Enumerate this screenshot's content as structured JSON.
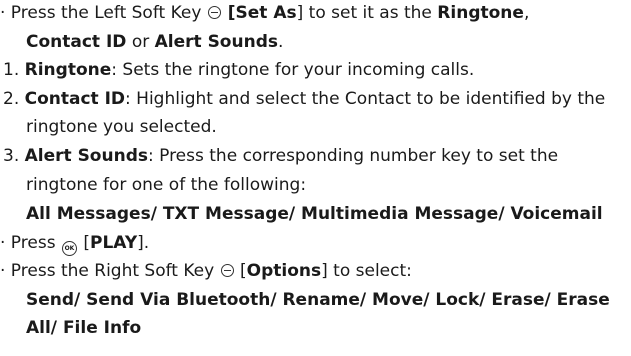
{
  "page": {
    "lines": [
      {
        "id": "l1",
        "parts": [
          {
            "t": "· Press the Left Soft Key "
          },
          {
            "icon": "left-soft-key-icon"
          },
          {
            "t": " [Set As",
            "b": true
          },
          {
            "t": "] to set it as the "
          },
          {
            "t": "Ringtone",
            "b": true
          },
          {
            "t": ","
          }
        ]
      },
      {
        "id": "l2",
        "parts": [
          {
            "t": "Contact ID",
            "b": true
          },
          {
            "t": " or "
          },
          {
            "t": "Alert Sounds",
            "b": true
          },
          {
            "t": "."
          }
        ]
      },
      {
        "id": "l3",
        "parts": [
          {
            "t": "1. "
          },
          {
            "t": "Ringtone",
            "b": true
          },
          {
            "t": ": Sets the ringtone for your incoming calls."
          }
        ]
      },
      {
        "id": "l4",
        "parts": [
          {
            "t": "2. "
          },
          {
            "t": "Contact ID",
            "b": true
          },
          {
            "t": ": Highlight and select the Contact to be identified by the"
          }
        ]
      },
      {
        "id": "l5",
        "parts": [
          {
            "t": "ringtone you selected."
          }
        ]
      },
      {
        "id": "l6",
        "parts": [
          {
            "t": "3. "
          },
          {
            "t": "Alert Sounds",
            "b": true
          },
          {
            "t": ": Press the corresponding number key to set the"
          }
        ]
      },
      {
        "id": "l7",
        "parts": [
          {
            "t": "ringtone for one of the following:"
          }
        ]
      },
      {
        "id": "l8",
        "parts": [
          {
            "t": "All Messages/ TXT Message/ Multimedia Message/ Voicemail",
            "b": true
          }
        ]
      },
      {
        "id": "l9",
        "parts": [
          {
            "t": "· Press "
          },
          {
            "icon": "ok-key-icon",
            "label": "OK"
          },
          {
            "t": " ["
          },
          {
            "t": "PLAY",
            "b": true
          },
          {
            "t": "]."
          }
        ]
      },
      {
        "id": "l10",
        "parts": [
          {
            "t": "· Press the Right Soft Key "
          },
          {
            "icon": "right-soft-key-icon"
          },
          {
            "t": " ["
          },
          {
            "t": "Options",
            "b": true
          },
          {
            "t": "] to select:"
          }
        ]
      },
      {
        "id": "l11",
        "parts": [
          {
            "t": "Send/ Send Via Bluetooth/ Rename/ Move/ Lock/ Erase/ Erase",
            "b": true
          }
        ]
      },
      {
        "id": "l12",
        "parts": [
          {
            "t": "All/ File Info",
            "b": true
          }
        ]
      }
    ]
  }
}
